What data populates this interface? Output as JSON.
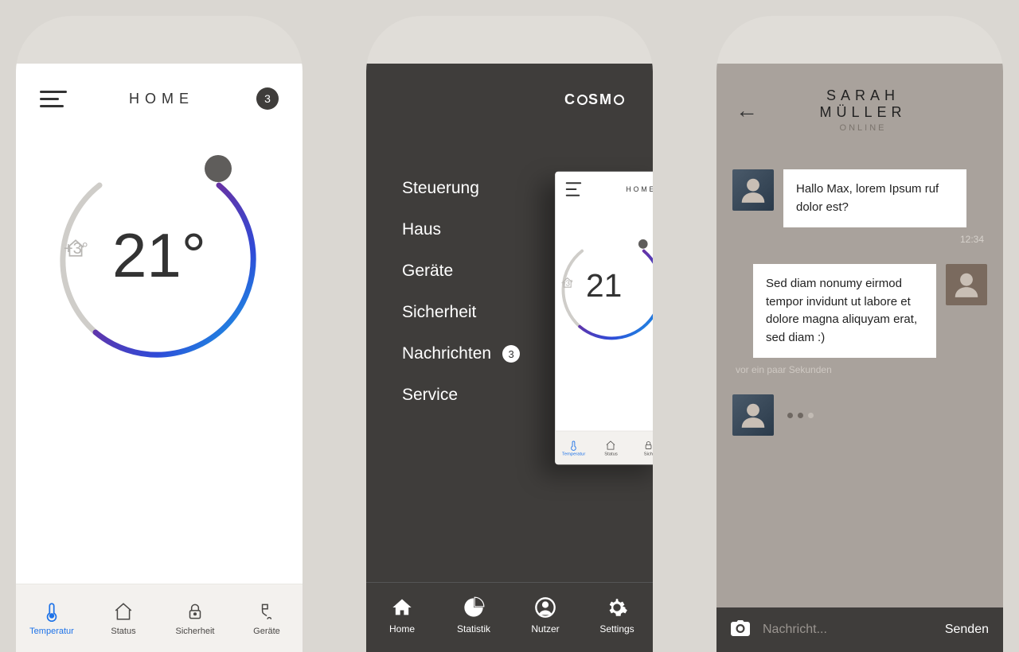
{
  "phone1": {
    "title": "HOME",
    "badge": "3",
    "temperature": "21°",
    "offset": "+3°",
    "tabs": [
      "Temperatur",
      "Status",
      "Sicherheit",
      "Geräte"
    ]
  },
  "phone2": {
    "brand_pre": "C",
    "brand_mid": "SM",
    "brand_post": "",
    "drawer": {
      "i0": "Steuerung",
      "i1": "Haus",
      "i2": "Geräte",
      "i3": "Sicherheit",
      "i4": "Nachrichten",
      "i4_badge": "3",
      "i5": "Service"
    },
    "mini": {
      "title": "HOME",
      "temperature": "21",
      "offset": "+3°",
      "tabs": [
        "Temperatur",
        "Status",
        "Sich"
      ]
    },
    "bottom": {
      "b0": "Home",
      "b1": "Statistik",
      "b2": "Nutzer",
      "b3": "Settings"
    }
  },
  "phone3": {
    "name": "SARAH MÜLLER",
    "status": "ONLINE",
    "m1": "Hallo Max, lorem Ipsum ruf dolor est?",
    "t1": "12:34",
    "m2": "Sed diam nonumy eirmod tempor invidunt ut labore et dolore magna aliquyam erat, sed diam  :)",
    "t2": "vor ein paar Sekunden",
    "placeholder": "Nachricht...",
    "send": "Senden"
  }
}
